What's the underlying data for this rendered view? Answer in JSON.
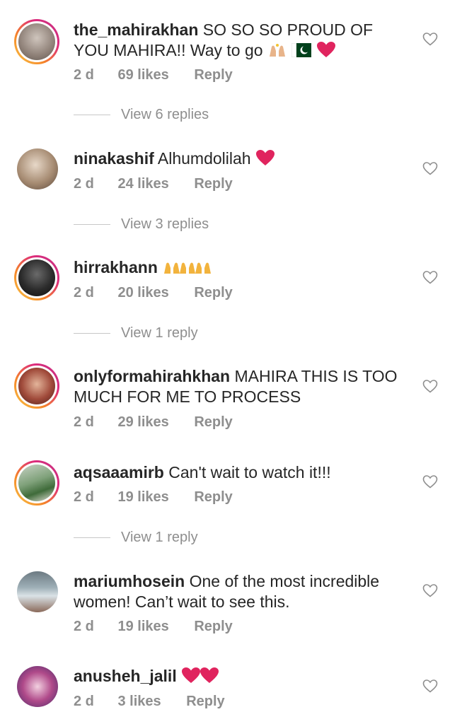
{
  "colors": {
    "heart_red": "#e0245e",
    "meta_gray": "#8e8e8e",
    "text": "#262626"
  },
  "comments": [
    {
      "username": "the_mahirakhan",
      "text": "SO SO SO PROUD OF YOU MAHIRA!! Way to go",
      "emojis": [
        "raised-hands",
        "pakistan-flag",
        "red-heart"
      ],
      "time": "2 d",
      "likes": "69 likes",
      "reply": "Reply",
      "view_replies": "View 6 replies"
    },
    {
      "username": "ninakashif",
      "text": "Alhumdolilah",
      "emojis": [
        "red-heart"
      ],
      "time": "2 d",
      "likes": "24 likes",
      "reply": "Reply",
      "view_replies": "View 3 replies"
    },
    {
      "username": "hirrakhann",
      "text": "",
      "emojis": [
        "raised-hands",
        "raised-hands",
        "raised-hands"
      ],
      "time": "2 d",
      "likes": "20 likes",
      "reply": "Reply",
      "view_replies": "View 1 reply"
    },
    {
      "username": "onlyformahirahkhan",
      "text": "MAHIRA THIS IS TOO MUCH FOR ME TO PROCESS",
      "emojis": [],
      "time": "2 d",
      "likes": "29 likes",
      "reply": "Reply",
      "view_replies": ""
    },
    {
      "username": "aqsaaamirb",
      "text": "Can't wait to watch it!!!",
      "emojis": [],
      "time": "2 d",
      "likes": "19 likes",
      "reply": "Reply",
      "view_replies": "View 1 reply"
    },
    {
      "username": "mariumhosein",
      "text": "One of the most incredible women! Can’t wait to see this.",
      "emojis": [],
      "time": "2 d",
      "likes": "19 likes",
      "reply": "Reply",
      "view_replies": ""
    },
    {
      "username": "anusheh_jalil",
      "text": "",
      "emojis": [
        "red-heart",
        "red-heart"
      ],
      "time": "2 d",
      "likes": "3 likes",
      "reply": "Reply",
      "view_replies": ""
    }
  ]
}
